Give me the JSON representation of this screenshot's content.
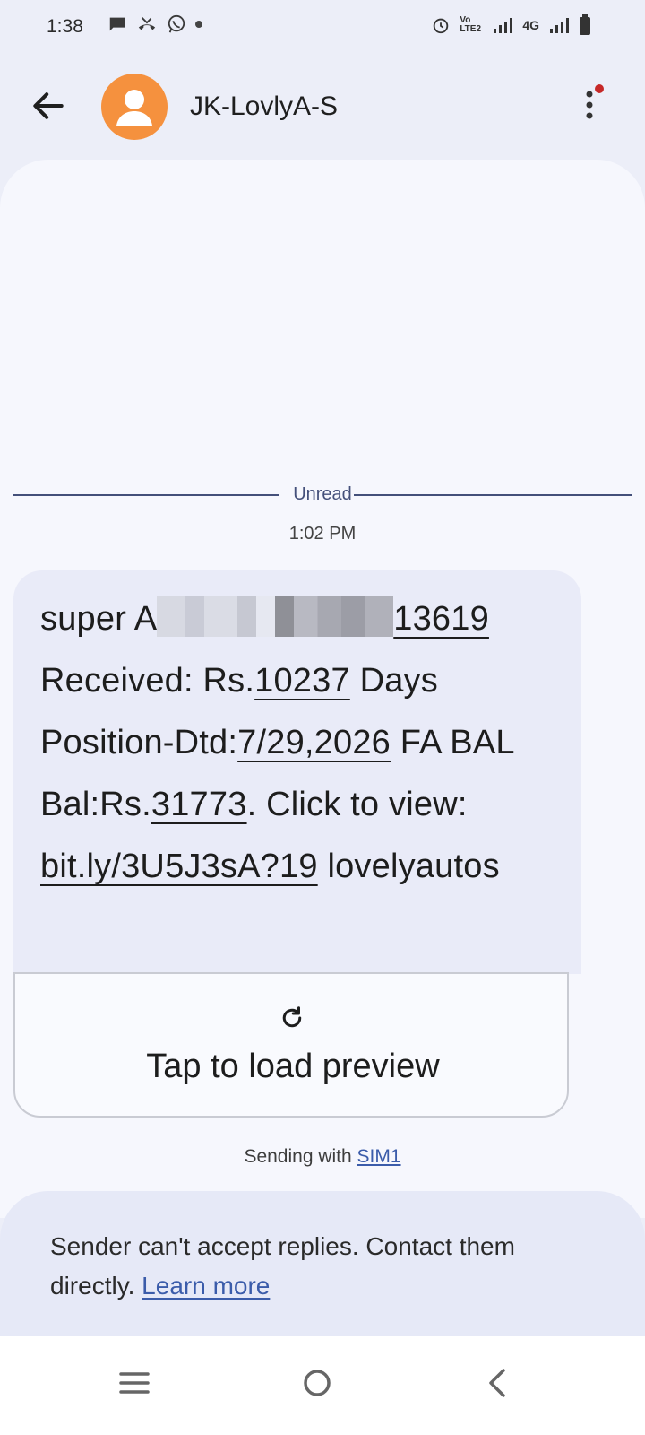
{
  "status_bar": {
    "time": "1:38",
    "network_labels": [
      "Vo LTE2",
      "4G"
    ]
  },
  "app_bar": {
    "contact_name": "JK-LovlyA-S",
    "avatar_color": "#f5913e",
    "notification_dot_color": "#c62828"
  },
  "conversation": {
    "unread_label": "Unread",
    "timestamp": "1:02 PM",
    "message": {
      "prefix": "super A",
      "account_tail": "13619",
      "received_label": "Received: Rs.",
      "received_amount": "10237",
      "days_label": " Days Position-Dtd:",
      "date": "7/29,2026",
      "fa_label": " FA BAL Bal:Rs.",
      "balance": "31773",
      "click_label": ". Click to view: ",
      "link": "bit.ly/3U5J3sA?19",
      "signature": "lovelyautos"
    },
    "preview_label": "Tap to load preview",
    "sending_prefix": "Sending with ",
    "sim_label": "SIM1"
  },
  "reply_notice": {
    "text": "Sender can't accept replies. Contact them directly. ",
    "link_label": "Learn more"
  },
  "icons": {
    "back": "back-arrow-icon",
    "more": "more-vert-icon",
    "refresh": "refresh-icon",
    "nav_recents": "recents-icon",
    "nav_home": "home-icon",
    "nav_back": "nav-back-icon"
  }
}
